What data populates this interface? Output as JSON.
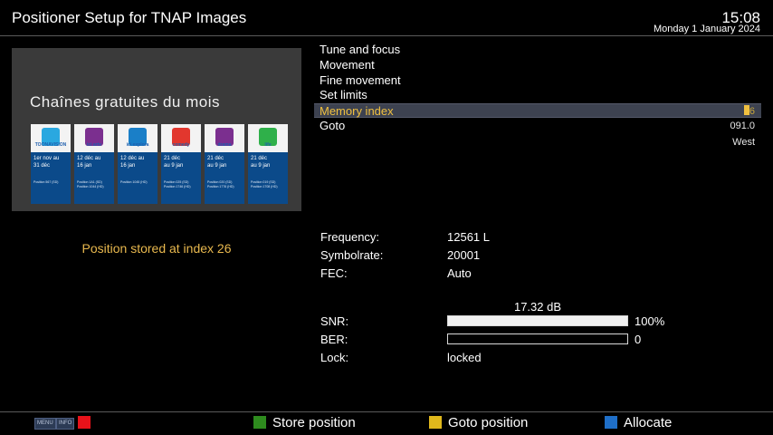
{
  "header": {
    "title": "Positioner Setup for TNAP Images",
    "time": "15:08",
    "date": "Monday  1 January 2024"
  },
  "preview": {
    "title": "Chaînes gratuites du mois",
    "channels": [
      {
        "logo": "TOONAVISION",
        "color": "#2aa8e0",
        "dates": "1er nov au\n31 déc",
        "fine": "Position 567 (SD)"
      },
      {
        "logo": "ici artv",
        "color": "#7b2f8f",
        "dates": "12 déc au\n16 jan",
        "fine": "Position 1A1 (SD)\nPosition 1044 (HD)"
      },
      {
        "logo": "ici explora",
        "color": "#1a7fc8",
        "dates": "12 déc au\n16 jan",
        "fine": "Position 1045 (HD)"
      },
      {
        "logo": "comedy",
        "color": "#e2372e",
        "dates": "21 déc\nau 9 jan",
        "fine": "Position 025 (SD)\nPosition 1746 (HD)"
      },
      {
        "logo": "drama",
        "color": "#7b2f8f",
        "dates": "21 déc\nau 9 jan",
        "fine": "Position 020 (SD)\nPosition 1776 (HD)"
      },
      {
        "logo": "life",
        "color": "#2fb04a",
        "dates": "21 déc\nau 9 jan",
        "fine": "Position 019 (SD)\nPosition 1708 (HD)"
      }
    ]
  },
  "status_message": "Position stored at index 26",
  "menu": {
    "items": [
      {
        "label": "Tune and focus",
        "value": ""
      },
      {
        "label": "Movement",
        "value": ""
      },
      {
        "label": "Fine movement",
        "value": ""
      },
      {
        "label": "Set limits",
        "value": ""
      },
      {
        "label": "Memory index",
        "value": "6",
        "selected": true
      },
      {
        "label": "Goto",
        "value": "091.0"
      }
    ],
    "goto_direction": "West"
  },
  "tuner": {
    "frequency_label": "Frequency:",
    "frequency": "12561 L",
    "symbolrate_label": "Symbolrate:",
    "symbolrate": "20001",
    "fec_label": "FEC:",
    "fec": "Auto",
    "snr_db": "17.32 dB",
    "snr_label": "SNR:",
    "snr_pct": "100%",
    "snr_fraction": 1.0,
    "ber_label": "BER:",
    "ber_value": "0",
    "ber_fraction": 0.0,
    "lock_label": "Lock:",
    "lock": "locked"
  },
  "footer": {
    "menu_btn": "MENU",
    "info_btn": "INFO",
    "green_label": "Store position",
    "yellow_label": "Goto position",
    "blue_label": "Allocate"
  },
  "colors": {
    "accent_yellow": "#f0c040",
    "status_text": "#e8b84e",
    "red_key": "#e8121a",
    "green_key": "#2e8b1e",
    "yellow_key": "#e0b81c",
    "blue_key": "#1f6fc8"
  }
}
